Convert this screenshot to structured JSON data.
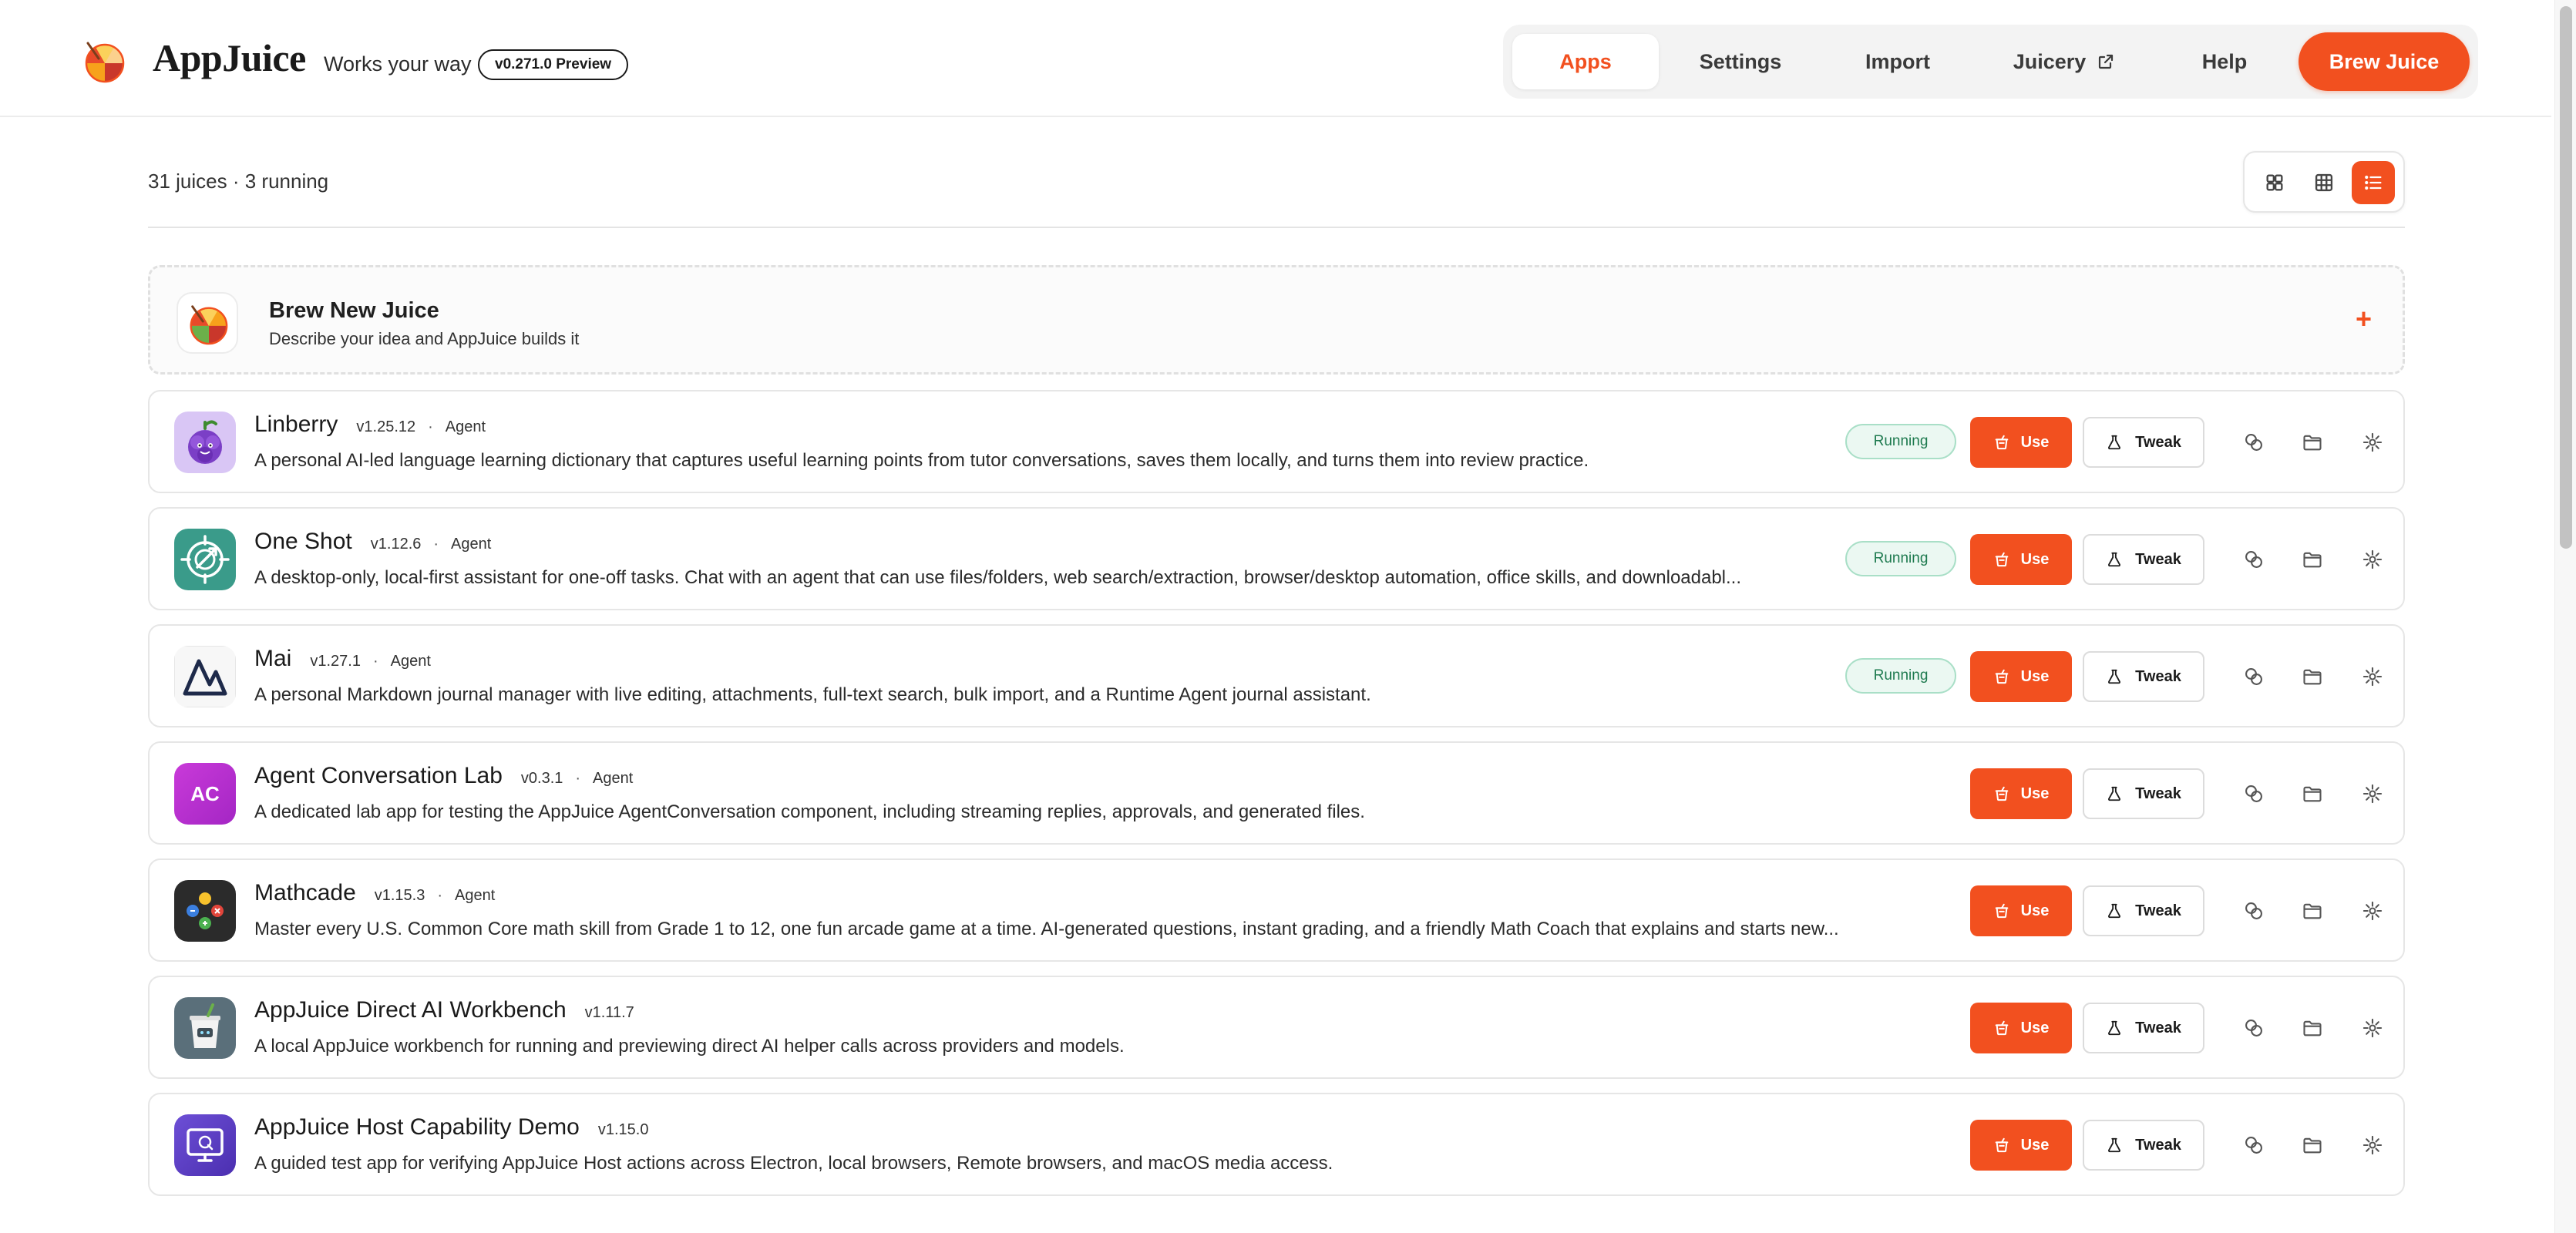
{
  "header": {
    "brand": "AppJuice",
    "tagline": "Works your way",
    "version": "v0.271.0 Preview",
    "nav": [
      {
        "label": "Apps",
        "active": true
      },
      {
        "label": "Settings",
        "active": false
      },
      {
        "label": "Import",
        "active": false
      },
      {
        "label": "Juicery",
        "active": false,
        "external": true
      },
      {
        "label": "Help",
        "active": false
      }
    ],
    "brew_label": "Brew Juice"
  },
  "toolbar": {
    "count": "31 juices · 3 running",
    "views": [
      "grid-large",
      "grid-small",
      "list"
    ],
    "active_view": "list"
  },
  "new_juice": {
    "title": "Brew New Juice",
    "subtitle": "Describe your idea and AppJuice builds it",
    "plus": "+"
  },
  "labels": {
    "running": "Running",
    "use": "Use",
    "tweak": "Tweak",
    "sep": "·"
  },
  "apps": [
    {
      "name": "Linberry",
      "version": "v1.25.12",
      "type": "Agent",
      "running": true,
      "icon": "grape-mascot-icon",
      "description": "A personal AI-led language learning dictionary that captures useful learning points from tutor conversations, saves them locally, and turns them into review practice."
    },
    {
      "name": "One Shot",
      "version": "v1.12.6",
      "type": "Agent",
      "running": true,
      "icon": "target-arrow-icon",
      "description": "A desktop-only, local-first assistant for one-off tasks. Chat with an agent that can use files/folders, web search/extraction, browser/desktop automation, office skills, and downloadabl..."
    },
    {
      "name": "Mai",
      "version": "v1.27.1",
      "type": "Agent",
      "running": true,
      "icon": "mountain-logo-icon",
      "description": "A personal Markdown journal manager with live editing, attachments, full-text search, bulk import, and a Runtime Agent journal assistant."
    },
    {
      "name": "Agent Conversation Lab",
      "version": "v0.3.1",
      "type": "Agent",
      "running": false,
      "icon": "initials-ac-icon",
      "initials": "AC",
      "description": "A dedicated lab app for testing the AppJuice AgentConversation component, including streaming replies, approvals, and generated files."
    },
    {
      "name": "Mathcade",
      "version": "v1.15.3",
      "type": "Agent",
      "running": false,
      "icon": "gamepad-icon",
      "description": "Master every U.S. Common Core math skill from Grade 1 to 12, one fun arcade game at a time. AI-generated questions, instant grading, and a friendly Math Coach that explains and starts new..."
    },
    {
      "name": "AppJuice Direct AI Workbench",
      "version": "v1.11.7",
      "type": "",
      "running": false,
      "icon": "juice-cup-icon",
      "description": "A local AppJuice workbench for running and previewing direct AI helper calls across providers and models."
    },
    {
      "name": "AppJuice Host Capability Demo",
      "version": "v1.15.0",
      "type": "",
      "running": false,
      "icon": "monitor-icon",
      "description": "A guided test app for verifying AppJuice Host actions across Electron, local browsers, Remote browsers, and macOS media access."
    }
  ],
  "colors": {
    "accent": "#f2501f",
    "running_bg": "#ebf8f2",
    "running_text": "#1e7a4f"
  }
}
